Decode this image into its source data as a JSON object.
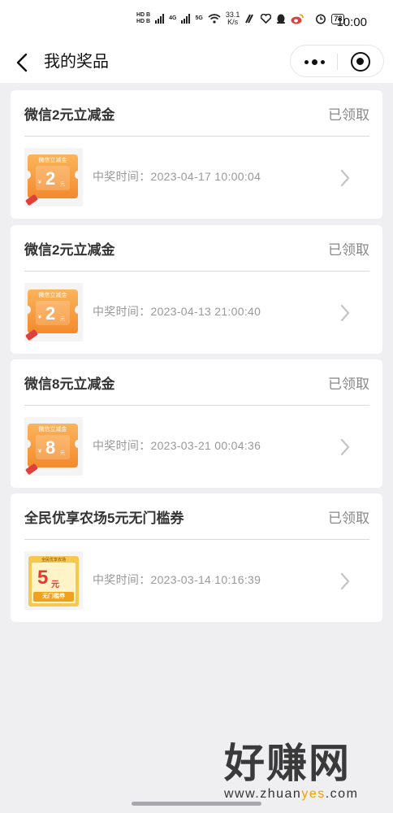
{
  "status_bar": {
    "hd_top": "HD B",
    "hd_bottom": "HD B",
    "net1": "4G",
    "net2": "5G",
    "net_speed_value": "33.1",
    "net_speed_unit": "K/s",
    "battery": "78",
    "time": "10:00",
    "icons": [
      "signal-icon",
      "wifi-icon",
      "nfc-icon",
      "heart-icon",
      "qq-icon",
      "weibo-icon",
      "alarm-icon"
    ]
  },
  "nav": {
    "title": "我的奖品"
  },
  "prizes": [
    {
      "title": "微信2元立减金",
      "status": "已领取",
      "time": "中奖时间：2023-04-17 10:00:04",
      "coupon_type": "wechat",
      "coupon_top": "微信立减金",
      "coupon_amount": "2",
      "coupon_unit": "元",
      "coupon_yen": "¥"
    },
    {
      "title": "微信2元立减金",
      "status": "已领取",
      "time": "中奖时间：2023-04-13 21:00:40",
      "coupon_type": "wechat",
      "coupon_top": "微信立减金",
      "coupon_amount": "2",
      "coupon_unit": "元",
      "coupon_yen": "¥"
    },
    {
      "title": "微信8元立减金",
      "status": "已领取",
      "time": "中奖时间：2023-03-21 00:04:36",
      "coupon_type": "wechat",
      "coupon_top": "微信立减金",
      "coupon_amount": "8",
      "coupon_unit": "元",
      "coupon_yen": "¥"
    },
    {
      "title": "全民优享农场5元无门槛券",
      "status": "已领取",
      "time": "中奖时间：2023-03-14 10:16:39",
      "coupon_type": "farm",
      "coupon_top": "全民优享农场",
      "coupon_amount": "5",
      "coupon_unit": "元",
      "coupon_bottom": "无门槛券"
    }
  ],
  "watermark": {
    "brand": "好赚网",
    "url_prefix": "www.zhuan",
    "url_highlight": "yes",
    "url_suffix": ".com"
  },
  "colors": {
    "background": "#efeff2",
    "card": "#ffffff",
    "coupon_orange": "#f38a2c",
    "farm_yellow": "#f6c84e",
    "farm_red": "#e8372c"
  }
}
